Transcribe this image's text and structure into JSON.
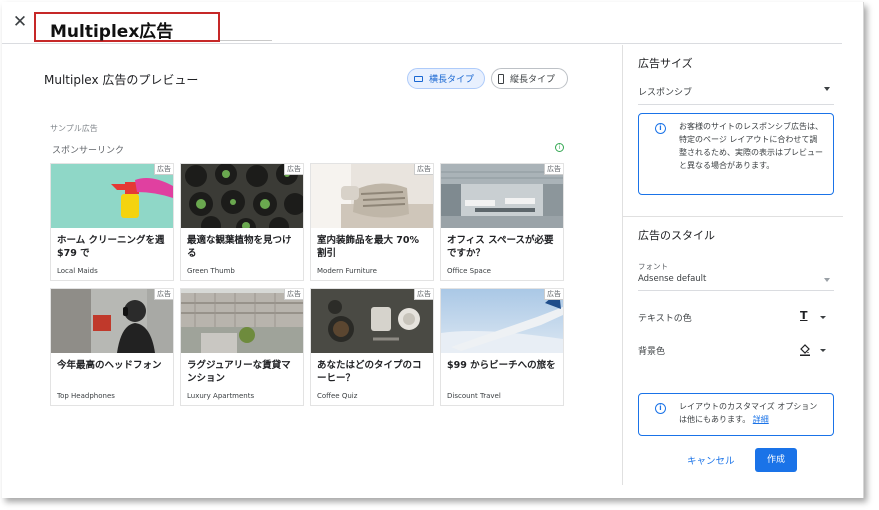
{
  "header": {
    "title": "Multiplex広告",
    "close_icon": "close-icon"
  },
  "preview": {
    "title": "Multiplex 広告のプレビュー",
    "toggles": [
      {
        "label": "横長タイプ",
        "active": true
      },
      {
        "label": "縦長タイプ",
        "active": false
      }
    ],
    "sample_label": "サンプル広告",
    "sponsor_label": "スポンサーリンク",
    "ad_badge": "広告",
    "cards": [
      {
        "headline": "ホーム クリーニングを週 $79 で",
        "advertiser": "Local Maids"
      },
      {
        "headline": "最適な観葉植物を見つける",
        "advertiser": "Green Thumb"
      },
      {
        "headline": "室内装飾品を最大 70% 割引",
        "advertiser": "Modern Furniture"
      },
      {
        "headline": "オフィス スペースが必要ですか？",
        "advertiser": "Office Space"
      },
      {
        "headline": "今年最高のヘッドフォン",
        "advertiser": "Top Headphones"
      },
      {
        "headline": "ラグジュアリーな賃貸マンション",
        "advertiser": "Luxury Apartments"
      },
      {
        "headline": "あなたはどのタイプのコーヒー？",
        "advertiser": "Coffee Quiz"
      },
      {
        "headline": "$99 からビーチへの旅を",
        "advertiser": "Discount Travel"
      }
    ]
  },
  "settings": {
    "ad_size_heading": "広告サイズ",
    "ad_size_value": "レスポンシブ",
    "ad_size_info": "お客様のサイトのレスポンシブ広告は、特定のページ レイアウトに合わせて調整されるため、実際の表示はプレビューと異なる場合があります。",
    "style_heading": "広告のスタイル",
    "font_label": "フォント",
    "font_value": "Adsense default",
    "text_color_label": "テキストの色",
    "bg_color_label": "背景色",
    "customize_info": "レイアウトのカスタマイズ オプションは他にもあります。",
    "customize_link": "詳細",
    "cancel_label": "キャンセル",
    "create_label": "作成"
  },
  "colors": {
    "accent": "#1a73e8",
    "highlight_border": "#c62828"
  }
}
